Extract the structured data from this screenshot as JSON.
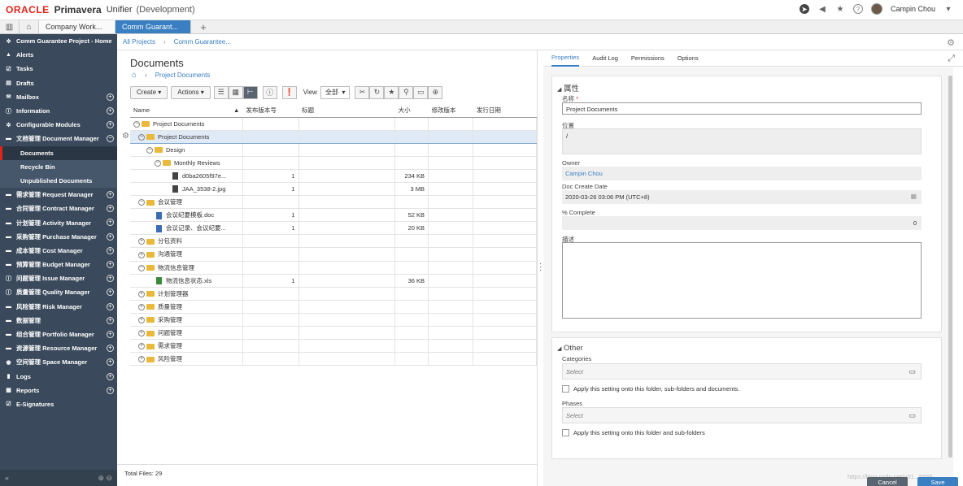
{
  "app": {
    "brand": "ORACLE",
    "product": "Primavera",
    "module": "Unifier",
    "env": "(Development)"
  },
  "topbar": {
    "user_name": "Campin Chou"
  },
  "tabs": {
    "company": "Company Work...",
    "project": "Comm Guarant..."
  },
  "sidebar": {
    "items": [
      {
        "label": "Comm Guarantee Project - Home",
        "icon": "gear-icon"
      },
      {
        "label": "Alerts",
        "icon": "bell-icon"
      },
      {
        "label": "Tasks",
        "icon": "check-icon"
      },
      {
        "label": "Drafts",
        "icon": "draft-icon"
      },
      {
        "label": "Mailbox",
        "icon": "mail-icon"
      },
      {
        "label": "Information",
        "icon": "info-icon"
      },
      {
        "label": "Configurable Modules",
        "icon": "gear-icon"
      },
      {
        "label": "文档管理 Document Manager",
        "icon": "folder-icon"
      }
    ],
    "subitems": [
      "Documents",
      "Recycle Bin",
      "Unpublished Documents"
    ],
    "items2": [
      {
        "label": "需求管理 Request Manager"
      },
      {
        "label": "合同管理 Contract Manager"
      },
      {
        "label": "计划管理 Activity Manager"
      },
      {
        "label": "采购管理 Purchase Manager"
      },
      {
        "label": "成本管理 Cost Manager"
      },
      {
        "label": "预算管理 Budget Manager"
      },
      {
        "label": "问题管理 Issue Manager"
      },
      {
        "label": "质量管理 Quality Manager"
      },
      {
        "label": "风险管理 Risk Manager"
      },
      {
        "label": "数据管理"
      },
      {
        "label": "组合管理 Portfolio Manager"
      },
      {
        "label": "资源管理 Resource Manager"
      },
      {
        "label": "空间管理 Space Manager"
      },
      {
        "label": "Logs"
      },
      {
        "label": "Reports"
      },
      {
        "label": "E-Signatures"
      }
    ]
  },
  "breadcrumb": {
    "root": "All Projects",
    "current": "Comm Guarantee..."
  },
  "docs": {
    "title": "Documents",
    "path": "Project Documents",
    "toolbar": {
      "create": "Create",
      "actions": "Actions",
      "view_label": "View",
      "view_value": "全部"
    },
    "columns": [
      "Name",
      "发布版本号",
      "标题",
      "大小",
      "修改版本",
      "发行日期"
    ],
    "rows": [
      {
        "name": "Project Documents",
        "ver": "",
        "size": ""
      },
      {
        "name": "Project Documents",
        "ver": "",
        "size": ""
      },
      {
        "name": "Design",
        "ver": "",
        "size": ""
      },
      {
        "name": "Monthly Reviews",
        "ver": "",
        "size": ""
      },
      {
        "name": "d0ba2605f97e...",
        "ver": "1",
        "size": "234 KB"
      },
      {
        "name": "JAA_3538-2.jpg",
        "ver": "1",
        "size": "3 MB"
      },
      {
        "name": "会议管理",
        "ver": "",
        "size": ""
      },
      {
        "name": "会议纪要模板.doc",
        "ver": "1",
        "size": "52 KB"
      },
      {
        "name": "会议记录、会议纪要...",
        "ver": "1",
        "size": "20 KB"
      },
      {
        "name": "分包资料",
        "ver": "",
        "size": ""
      },
      {
        "name": "沟通管理",
        "ver": "",
        "size": ""
      },
      {
        "name": "物流信息管理",
        "ver": "",
        "size": ""
      },
      {
        "name": "物流信息状态.xls",
        "ver": "1",
        "size": "36 KB"
      },
      {
        "name": "计划管理器",
        "ver": "",
        "size": ""
      },
      {
        "name": "质量管理",
        "ver": "",
        "size": ""
      },
      {
        "name": "采购管理",
        "ver": "",
        "size": ""
      },
      {
        "name": "问题管理",
        "ver": "",
        "size": ""
      },
      {
        "name": "需求管理",
        "ver": "",
        "size": ""
      },
      {
        "name": "风险管理",
        "ver": "",
        "size": ""
      }
    ],
    "total_files": "Total Files: 29"
  },
  "panel": {
    "tabs": [
      "Properties",
      "Audit Log",
      "Permissions",
      "Options"
    ],
    "props_title": "属性",
    "name_label": "名称",
    "name_required": "*",
    "name_value": "Project Documents",
    "location_label": "位置",
    "location_value": "/",
    "owner_label": "Owner",
    "owner_value": "Campin Chou",
    "date_label": "Doc Create Date",
    "date_value": "2020-03-26 03:06 PM  (UTC+8)",
    "pct_label": "% Complete",
    "pct_value": "0",
    "desc_label": "描述",
    "other_title": "Other",
    "categories_label": "Categories",
    "select_placeholder": "Select",
    "apply_all": "Apply this setting onto this folder, sub-folders and documents.",
    "phases_label": "Phases",
    "apply_folders": "Apply this setting onto this folder and sub-folders",
    "cancel": "Cancel",
    "save": "Save"
  },
  "watermark": "https://blog.csdn.net/u01...5555",
  "colors": {
    "accent": "#3a7fc1",
    "sidebar": "#3a4a5c",
    "brand": "#e2231a"
  }
}
